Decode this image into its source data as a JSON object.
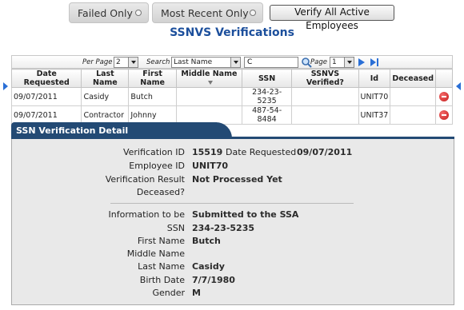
{
  "filters": {
    "failed_only": "Failed Only",
    "most_recent_only": "Most Recent Only",
    "verify_all": "Verify All Active Employees"
  },
  "page_title": "SSNVS Verifications",
  "pager": {
    "per_page_label": "Per Page",
    "per_page_value": "2",
    "search_label": "Search",
    "search_field": "Last Name",
    "search_value": "C",
    "page_label": "Page",
    "page_value": "1"
  },
  "grid": {
    "columns": [
      "Date Requested",
      "Last Name",
      "First Name",
      "Middle Name",
      "SSN",
      "SSNVS Verified?",
      "Id",
      "Deceased"
    ],
    "rows": [
      [
        "09/07/2011",
        "Casidy",
        "Butch",
        "",
        "234-23-5235",
        "",
        "UNIT70",
        ""
      ],
      [
        "09/07/2011",
        "Contractor",
        "Johnny",
        "",
        "487-54-8484",
        "",
        "UNIT37",
        ""
      ]
    ]
  },
  "detail": {
    "title": "SSN Verification Detail",
    "verification_id_label": "Verification ID",
    "verification_id": "15519",
    "date_requested_label": "Date Requested",
    "date_requested": "09/07/2011",
    "employee_id_label": "Employee ID",
    "employee_id": "UNIT70",
    "verification_result_label": "Verification Result",
    "verification_result": "Not Processed Yet",
    "deceased_label": "Deceased?",
    "submission_heading_left": "Information to be",
    "submission_heading_right": "Submitted to the SSA",
    "ssn_label": "SSN",
    "ssn": "234-23-5235",
    "first_name_label": "First Name",
    "first_name": "Butch",
    "middle_name_label": "Middle Name",
    "last_name_label": "Last Name",
    "last_name": "Casidy",
    "birth_date_label": "Birth Date",
    "birth_date": "7/7/1980",
    "gender_label": "Gender",
    "gender": "M"
  },
  "colors": {
    "title_blue": "#1c4f9c",
    "panel_header": "#234a74",
    "panel_body": "#e9e9e9",
    "row_arrow": "#2a6fd6",
    "delete_red": "#d22d2d"
  },
  "icons": {
    "search": "search-icon",
    "next_page": "next-page-icon",
    "last_page": "last-page-icon",
    "sort": "sort-arrow-icon",
    "delete": "delete-icon",
    "row_pointer": "row-pointer-icon"
  }
}
